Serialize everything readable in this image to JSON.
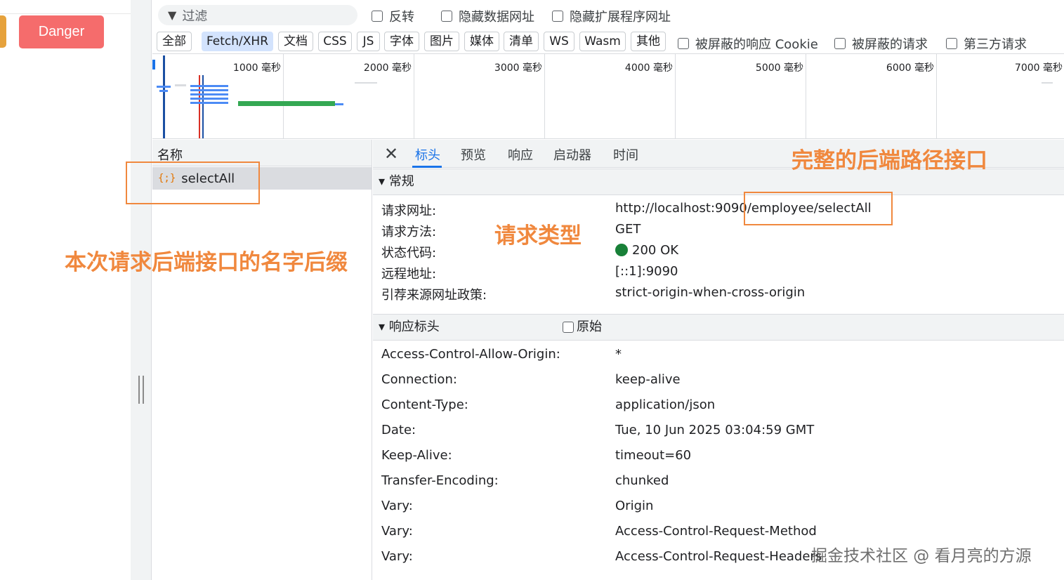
{
  "page": {
    "danger_button": "Danger"
  },
  "toolbar": {
    "filter_placeholder": "过滤",
    "invert_label": "反转",
    "hide_data_urls_label": "隐藏数据网址",
    "hide_extension_urls_label": "隐藏扩展程序网址"
  },
  "type_filters": [
    {
      "label": "全部",
      "active": false
    },
    {
      "label": "Fetch/XHR",
      "active": true
    },
    {
      "label": "文档",
      "active": false
    },
    {
      "label": "CSS",
      "active": false
    },
    {
      "label": "JS",
      "active": false
    },
    {
      "label": "字体",
      "active": false
    },
    {
      "label": "图片",
      "active": false
    },
    {
      "label": "媒体",
      "active": false
    },
    {
      "label": "清单",
      "active": false
    },
    {
      "label": "WS",
      "active": false
    },
    {
      "label": "Wasm",
      "active": false
    },
    {
      "label": "其他",
      "active": false
    }
  ],
  "extra_filters": {
    "blocked_cookies_label": "被屏蔽的响应 Cookie",
    "blocked_requests_label": "被屏蔽的请求",
    "third_party_label": "第三方请求"
  },
  "overview": {
    "tick_labels": [
      "1000 毫秒",
      "2000 毫秒",
      "3000 毫秒",
      "4000 毫秒",
      "5000 毫秒",
      "6000 毫秒",
      "7000 毫秒"
    ]
  },
  "requests": {
    "column_name": "名称",
    "selected_request": "selectAll",
    "request_icon": "{;}"
  },
  "details": {
    "close_glyph": "✕",
    "tabs": [
      "标头",
      "预览",
      "响应",
      "启动器",
      "时间"
    ],
    "active_tab": "标头",
    "general": {
      "title": "▾ 常规",
      "rows": [
        {
          "key": "请求网址:",
          "value": "http://localhost:9090/employee/selectAll"
        },
        {
          "key": "请求方法:",
          "value": "GET"
        },
        {
          "key": "状态代码:",
          "value": "200 OK"
        },
        {
          "key": "远程地址:",
          "value": "[::1]:9090"
        },
        {
          "key": "引荐来源网址政策:",
          "value": "strict-origin-when-cross-origin"
        }
      ]
    },
    "response_headers": {
      "title": "▾ 响应标头",
      "raw_label": "原始",
      "rows": [
        {
          "key": "Access-Control-Allow-Origin:",
          "value": "*"
        },
        {
          "key": "Connection:",
          "value": "keep-alive"
        },
        {
          "key": "Content-Type:",
          "value": "application/json"
        },
        {
          "key": "Date:",
          "value": "Tue, 10 Jun 2025 03:04:59 GMT"
        },
        {
          "key": "Keep-Alive:",
          "value": "timeout=60"
        },
        {
          "key": "Transfer-Encoding:",
          "value": "chunked"
        },
        {
          "key": "Vary:",
          "value": "Origin"
        },
        {
          "key": "Vary:",
          "value": "Access-Control-Request-Method"
        },
        {
          "key": "Vary:",
          "value": "Access-Control-Request-Headers"
        }
      ]
    }
  },
  "annotations": {
    "backend_path": "完整的后端路径接口",
    "request_type": "请求类型",
    "name_suffix": "本次请求后端接口的名字后缀",
    "color": "#f0883e"
  },
  "watermark": "掘金技术社区 @ 看月亮的方源",
  "colors": {
    "danger": "#f56c6c",
    "warning": "#e6a23c",
    "accent": "#1a73e8",
    "status_ok": "#188038",
    "active_filter_bg": "#d3e3fd"
  }
}
